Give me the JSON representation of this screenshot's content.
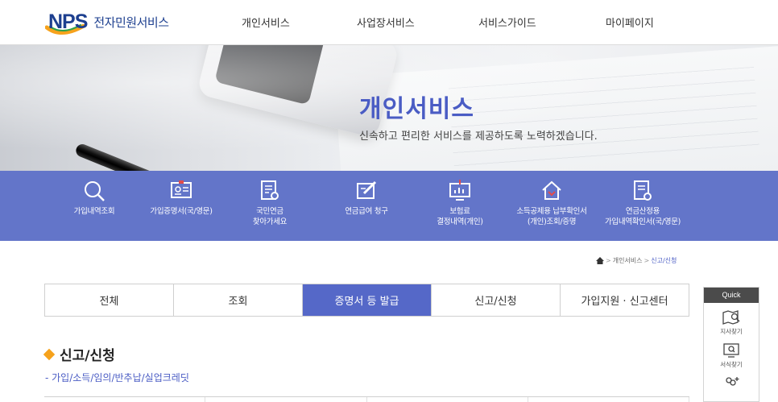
{
  "header": {
    "logo_mark": "NPS",
    "logo_text": "전자민원서비스",
    "nav": [
      "개인서비스",
      "사업장서비스",
      "서비스가이드",
      "마이페이지"
    ]
  },
  "hero": {
    "title": "개인서비스",
    "subtitle": "신속하고 편리한 서비스를 제공하도록 노력하겠습니다."
  },
  "services": [
    {
      "label": "가입내역조회",
      "icon": "search-icon"
    },
    {
      "label": "가입증명서(국/영문)",
      "icon": "id-card-icon"
    },
    {
      "label": "국민연금\n찾아가세요",
      "icon": "document-search-icon"
    },
    {
      "label": "연금급여 청구",
      "icon": "form-pen-icon"
    },
    {
      "label": "보험료\n결정내역(개인)",
      "icon": "chart-monitor-icon"
    },
    {
      "label": "소득공제용 납부확인서\n(개인)조회/증명",
      "icon": "house-icon"
    },
    {
      "label": "연금산정용\n가입내역확인서(국/영문)",
      "icon": "document-check-icon"
    }
  ],
  "breadcrumb": {
    "home_icon": "home-icon",
    "items": [
      "개인서비스",
      "신고/신청"
    ]
  },
  "tabs": [
    {
      "label": "전체",
      "active": false
    },
    {
      "label": "조회",
      "active": false
    },
    {
      "label": "증명서 등 발급",
      "active": true
    },
    {
      "label": "신고/신청",
      "active": false
    },
    {
      "label": "가입지원 · 신고센터",
      "active": false
    }
  ],
  "section": {
    "title": "신고/신청",
    "subtitle": "- 가입/소득/임의/반추납/실업크레딧"
  },
  "quick": {
    "title": "Quick",
    "items": [
      {
        "label": "지사찾기",
        "icon": "map-search-icon"
      },
      {
        "label": "서식찾기",
        "icon": "monitor-search-icon"
      },
      {
        "label": "",
        "icon": "people-add-icon"
      }
    ]
  },
  "colors": {
    "brand_blue": "#1d3f8f",
    "accent": "#5568c8",
    "service_bar": "#6375c9",
    "orange": "#f6a21c"
  }
}
